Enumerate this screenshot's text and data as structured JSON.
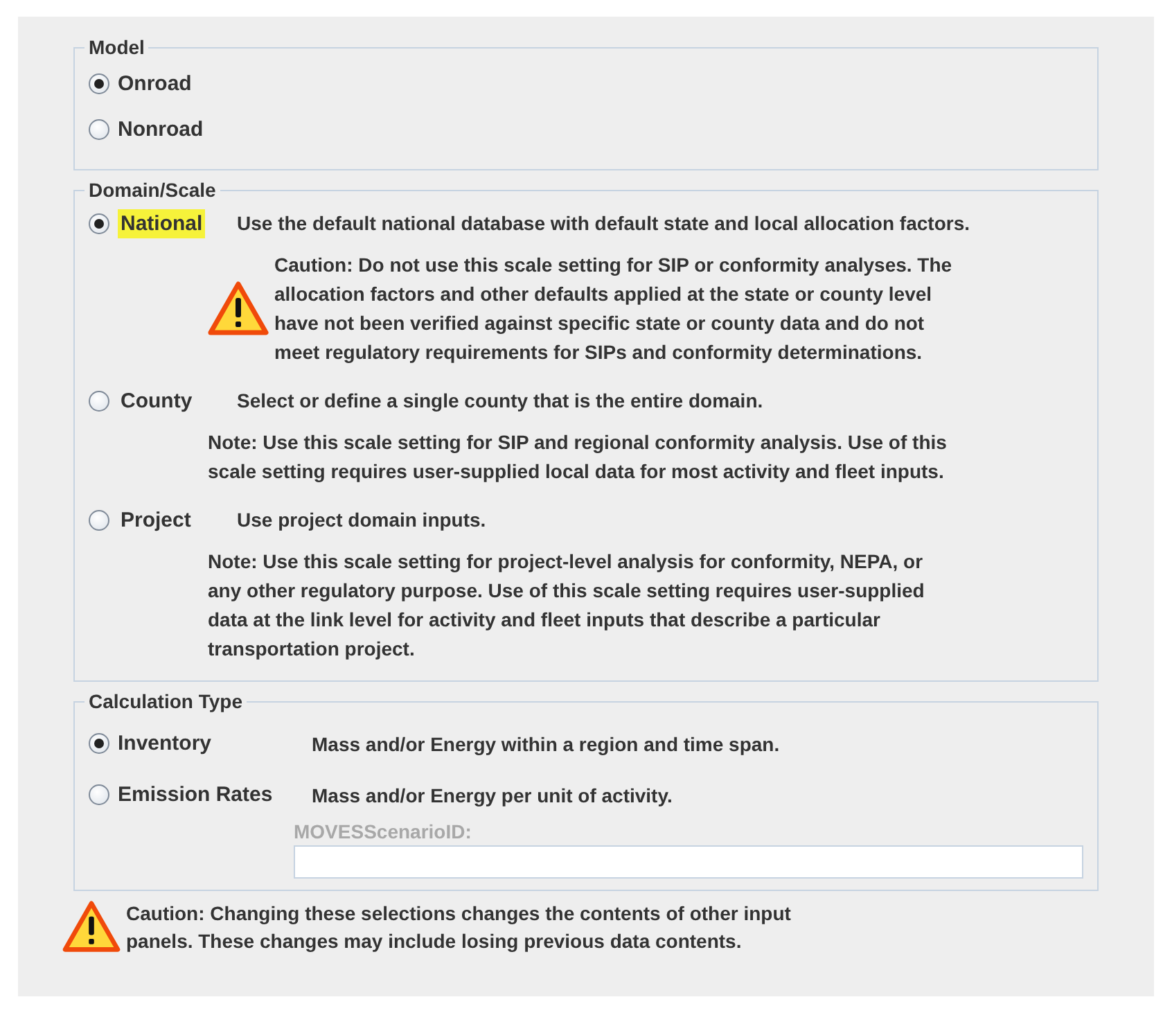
{
  "model": {
    "title": "Model",
    "options": [
      {
        "label": "Onroad",
        "selected": true
      },
      {
        "label": "Nonroad",
        "selected": false
      }
    ]
  },
  "domain": {
    "title": "Domain/Scale",
    "options": [
      {
        "label": "National",
        "selected": true,
        "highlighted": true,
        "description": "Use the default national database with default state and local allocation factors.",
        "caution": "Caution: Do not use this scale setting for SIP or conformity analyses. The allocation factors and other defaults applied at the state or county level have not been verified against specific state or county data and do not meet regulatory requirements for SIPs and conformity determinations."
      },
      {
        "label": "County",
        "selected": false,
        "highlighted": false,
        "description": "Select or define a single county that is the entire domain.",
        "note": "Note: Use this scale setting for SIP and regional conformity analysis. Use of this scale setting requires user-supplied local data for most activity and fleet inputs."
      },
      {
        "label": "Project",
        "selected": false,
        "highlighted": false,
        "description": "Use project domain inputs.",
        "note": "Note: Use this scale setting for project-level analysis for conformity, NEPA, or any other regulatory purpose. Use of this scale setting requires user-supplied data at the link level for activity and fleet inputs that describe a particular transportation project."
      }
    ]
  },
  "calculation": {
    "title": "Calculation Type",
    "options": [
      {
        "label": "Inventory",
        "selected": true,
        "description": "Mass and/or Energy within a region and time span."
      },
      {
        "label": "Emission Rates",
        "selected": false,
        "description": "Mass and/or Energy per unit of activity."
      }
    ],
    "scenario_field": {
      "label": "MOVESScenarioID:",
      "disabled": true
    }
  },
  "footer_caution": "Caution: Changing these selections changes the contents of other input panels. These changes may include losing previous data contents."
}
